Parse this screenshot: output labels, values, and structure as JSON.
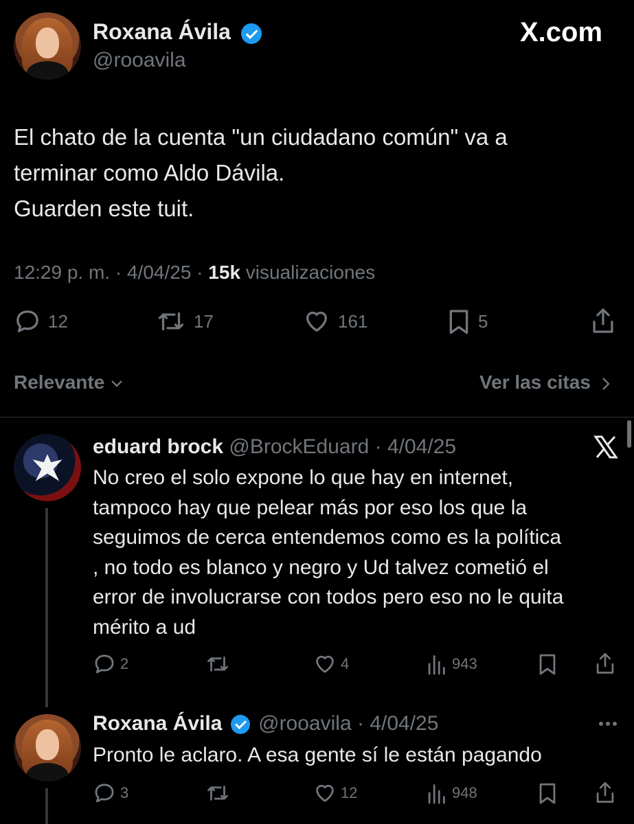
{
  "header": {
    "name": "Roxana Ávila",
    "handle": "@rooavila",
    "brand": "X.com"
  },
  "tweet": {
    "text_lines": [
      "El chato de la cuenta \"un ciudadano común\" va a",
      "terminar como Aldo Dávila.",
      "Guarden este tuit."
    ],
    "time": "12:29 p. m.",
    "date": "4/04/25",
    "views_count": "15k",
    "views_label": "visualizaciones",
    "replies": "12",
    "retweets": "17",
    "likes": "161",
    "bookmarks": "5"
  },
  "sort": {
    "label": "Relevante",
    "quotes_link": "Ver las citas"
  },
  "replies": [
    {
      "name": "eduard brock",
      "handle": "@BrockEduard",
      "date": "4/04/25",
      "text_lines": [
        "No creo el solo expone lo que hay en internet,",
        "tampoco hay que pelear más por eso los que la",
        "seguimos de cerca entendemos como es la política",
        ", no todo es blanco y negro y Ud talvez cometió el",
        "error de involucrarse con todos pero eso no le quita",
        "mérito a ud"
      ],
      "replies": "2",
      "likes": "4",
      "views": "943"
    },
    {
      "name": "Roxana Ávila",
      "handle": "@rooavila",
      "date": "4/04/25",
      "text_lines": [
        "Pronto le aclaro. A esa gente sí le están pagando"
      ],
      "replies": "3",
      "likes": "12",
      "views": "948"
    }
  ],
  "separator": "·"
}
